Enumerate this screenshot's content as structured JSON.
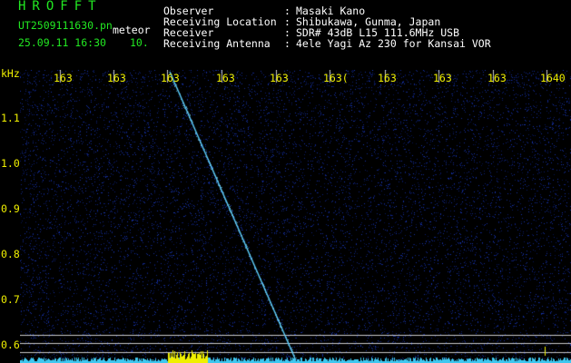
{
  "header": {
    "brand": "HROFFT",
    "filename": "UT2509111630.pn",
    "mode": "meteor",
    "datetime": "25.09.11 16:30",
    "level": "10.",
    "fields": [
      {
        "label": "Observer",
        "sep": ":",
        "value": "Masaki Kano"
      },
      {
        "label": "Receiving Location",
        "sep": ":",
        "value": "Shibukawa, Gunma, Japan"
      },
      {
        "label": "Receiver",
        "sep": ":",
        "value": "SDR# 43dB L15 111.6MHz USB"
      },
      {
        "label": "Receiving Antenna",
        "sep": ":",
        "value": "4ele Yagi Az 230 for Kansai VOR"
      }
    ]
  },
  "spectrogram": {
    "freq_unit": "kHz",
    "y_ticks": [
      "1.1",
      "1.0",
      "0.9",
      "0.8",
      "0.7",
      "0.6"
    ],
    "time_ticks": [
      "163",
      "163",
      "163",
      "163",
      "163",
      "163(",
      "163",
      "163",
      "163",
      "1640"
    ],
    "colors": {
      "background": "#000000",
      "noise": "#0a1a6e",
      "trace": "#5ad0ff",
      "grid": "#c8c8c8",
      "labels": "#f0f000",
      "header_brand": "#22e822",
      "header_info": "#ffffff"
    }
  }
}
